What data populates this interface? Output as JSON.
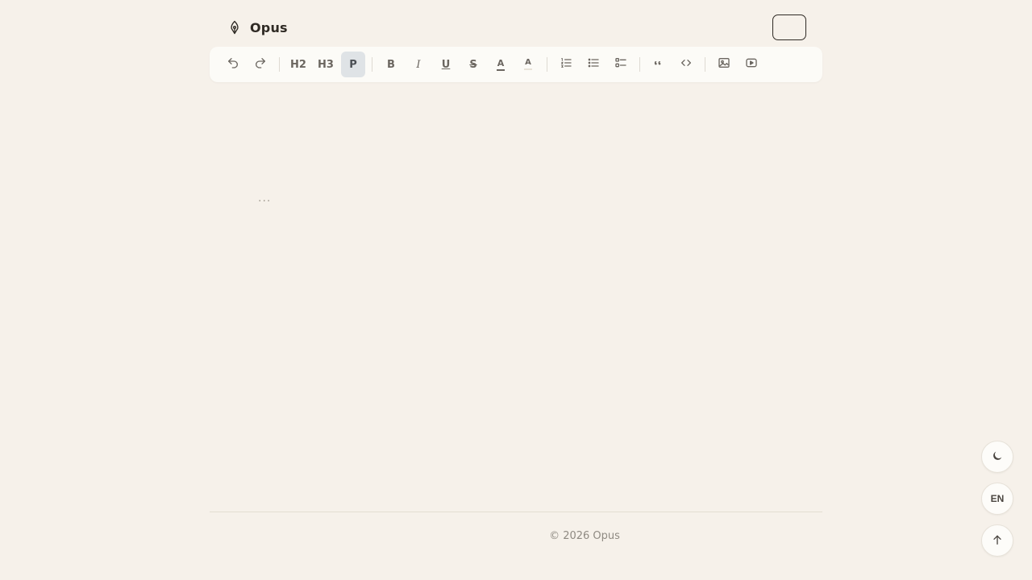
{
  "header": {
    "brand": "Opus",
    "brand_icon": "pen-nib-icon"
  },
  "toolbar": {
    "items": [
      {
        "type": "button",
        "name": "undo-button",
        "icon": "undo-icon"
      },
      {
        "type": "button",
        "name": "redo-button",
        "icon": "redo-icon"
      },
      {
        "type": "separator"
      },
      {
        "type": "button",
        "name": "heading2-button",
        "label": "H2"
      },
      {
        "type": "button",
        "name": "heading3-button",
        "label": "H3"
      },
      {
        "type": "button",
        "name": "paragraph-button",
        "label": "P",
        "active": true
      },
      {
        "type": "separator"
      },
      {
        "type": "button",
        "name": "bold-button",
        "label": "B",
        "icon": "bold-icon"
      },
      {
        "type": "button",
        "name": "italic-button",
        "label": "I",
        "icon": "italic-icon"
      },
      {
        "type": "button",
        "name": "underline-button",
        "label": "U",
        "icon": "underline-icon"
      },
      {
        "type": "button",
        "name": "strikethrough-button",
        "label": "S",
        "icon": "strikethrough-icon"
      },
      {
        "type": "button",
        "name": "text-color-button",
        "label": "A",
        "icon": "text-color-icon"
      },
      {
        "type": "button",
        "name": "highlight-color-button",
        "label": "A",
        "icon": "highlight-icon"
      },
      {
        "type": "separator"
      },
      {
        "type": "button",
        "name": "ordered-list-button",
        "icon": "ordered-list-icon"
      },
      {
        "type": "button",
        "name": "bullet-list-button",
        "icon": "bullet-list-icon"
      },
      {
        "type": "button",
        "name": "task-list-button",
        "icon": "task-list-icon"
      },
      {
        "type": "separator"
      },
      {
        "type": "button",
        "name": "blockquote-button",
        "icon": "quote-icon"
      },
      {
        "type": "button",
        "name": "code-button",
        "icon": "code-icon"
      },
      {
        "type": "separator"
      },
      {
        "type": "button",
        "name": "image-button",
        "icon": "image-icon"
      },
      {
        "type": "button",
        "name": "video-button",
        "icon": "video-icon"
      }
    ]
  },
  "editor": {
    "placeholder": "..."
  },
  "footer": {
    "copyright": "© 2026 Opus"
  },
  "floating": {
    "theme_icon": "moon-icon",
    "language_label": "EN",
    "scroll_top_icon": "arrow-up-icon"
  },
  "colors": {
    "background": "#f6f1ea",
    "toolbar_bg": "#fcfbf7",
    "active_bg": "#dfe3e6",
    "text": "#2f2a24",
    "muted": "#8f8a82"
  }
}
